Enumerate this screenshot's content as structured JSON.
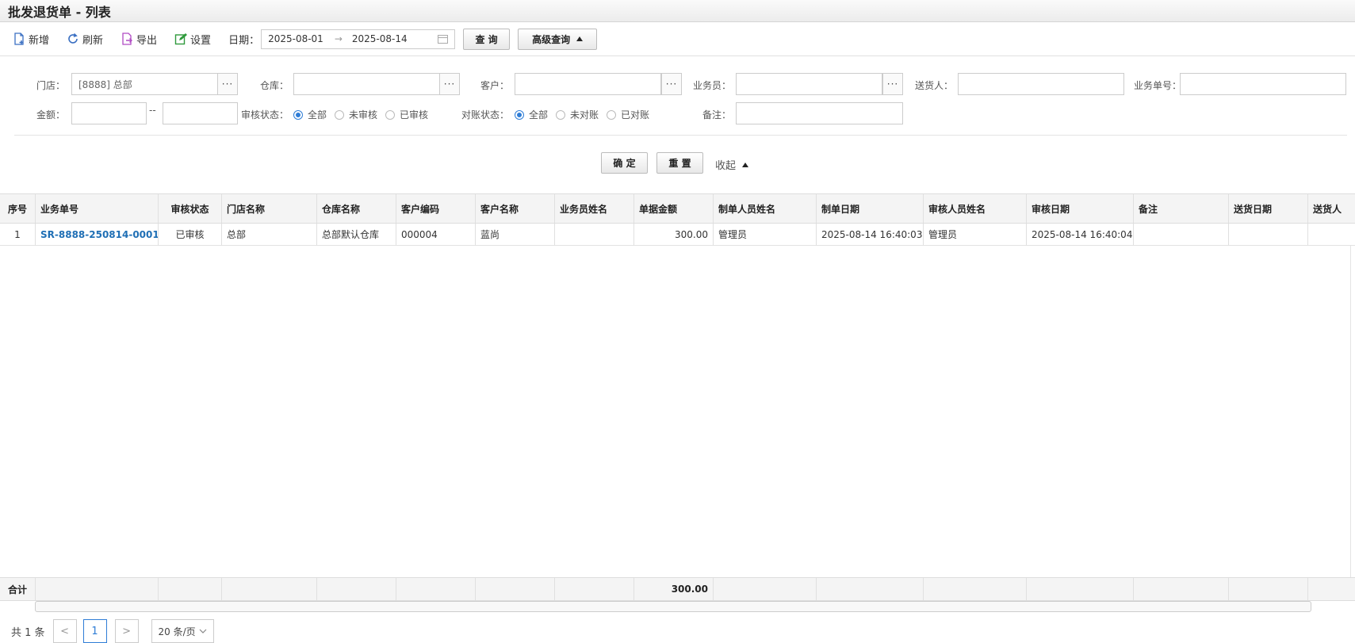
{
  "window": {
    "title": "批发退货单 - 列表"
  },
  "toolbar": {
    "add": "新增",
    "refresh": "刷新",
    "export": "导出",
    "settings": "设置",
    "date_label": "日期：",
    "date_from": "2025-08-01",
    "date_arrow": "→",
    "date_to": "2025-08-14",
    "query": "查 询",
    "advanced_query": "高级查询"
  },
  "filter": {
    "store_label": "门店：",
    "store_value": "[8888] 总部",
    "warehouse_label": "仓库：",
    "warehouse_value": "",
    "customer_label": "客户：",
    "customer_value": "",
    "salesman_label": "业务员：",
    "salesman_value": "",
    "deliverer_label": "送货人：",
    "deliverer_value": "",
    "doc_no_label": "业务单号：",
    "doc_no_value": "",
    "amount_label": "金额：",
    "amount_sep": "--",
    "audit_label": "审核状态：",
    "audit_options": [
      "全部",
      "未审核",
      "已审核"
    ],
    "audit_selected": "全部",
    "reconcile_label": "对账状态：",
    "reconcile_options": [
      "全部",
      "未对账",
      "已对账"
    ],
    "reconcile_selected": "全部",
    "remark_label": "备注：",
    "remark_value": "",
    "dots": "···",
    "confirm": "确 定",
    "reset": "重 置",
    "collapse": "收起"
  },
  "table": {
    "columns": [
      "序号",
      "业务单号",
      "审核状态",
      "门店名称",
      "仓库名称",
      "客户编码",
      "客户名称",
      "业务员姓名",
      "单据金额",
      "制单人员姓名",
      "制单日期",
      "审核人员姓名",
      "审核日期",
      "备注",
      "送货日期",
      "送货人"
    ],
    "rows": [
      [
        "1",
        "SR-8888-250814-0001",
        "已审核",
        "总部",
        "总部默认仓库",
        "000004",
        "蓝尚",
        "",
        "300.00",
        "管理员",
        "2025-08-14 16:40:03",
        "管理员",
        "2025-08-14 16:40:04",
        "",
        "",
        ""
      ]
    ],
    "footer": {
      "label": "合计",
      "amount_total": "300.00"
    }
  },
  "pager": {
    "total": "共 1 条",
    "prev": "<",
    "current": "1",
    "next": ">",
    "page_size": "20 条/页"
  },
  "colors": {
    "accent": "#2f7dd6",
    "link": "#1f6fb5"
  }
}
